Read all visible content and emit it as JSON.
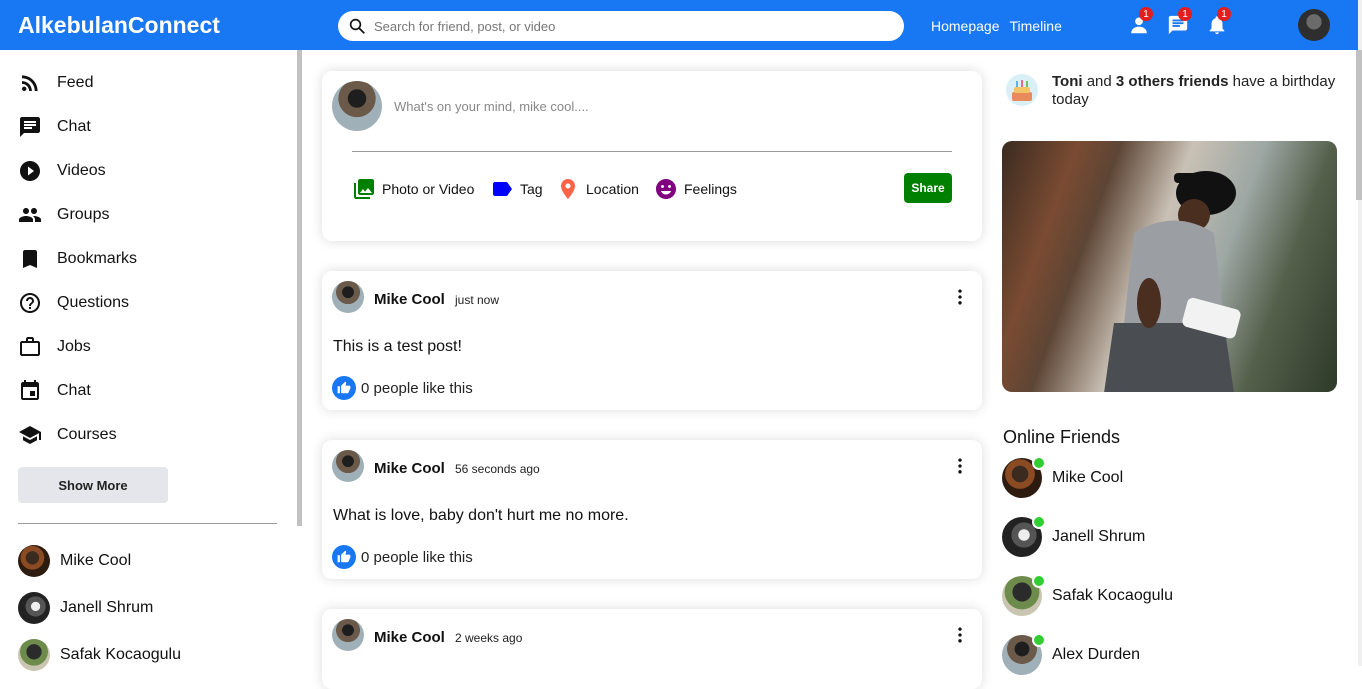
{
  "topbar": {
    "logo": "AlkebulanConnect",
    "search_placeholder": "Search for friend, post, or video",
    "links": [
      "Homepage",
      "Timeline"
    ],
    "badges": {
      "friends": "1",
      "messages": "1",
      "notifications": "1"
    }
  },
  "sidebar": {
    "items": [
      {
        "label": "Feed",
        "icon": "rss-feed-icon"
      },
      {
        "label": "Chat",
        "icon": "chat-icon"
      },
      {
        "label": "Videos",
        "icon": "play-circle-icon"
      },
      {
        "label": "Groups",
        "icon": "group-icon"
      },
      {
        "label": "Bookmarks",
        "icon": "bookmark-icon"
      },
      {
        "label": "Questions",
        "icon": "help-outline-icon"
      },
      {
        "label": "Jobs",
        "icon": "work-outline-icon"
      },
      {
        "label": "Chat",
        "icon": "event-icon"
      },
      {
        "label": "Courses",
        "icon": "school-icon"
      }
    ],
    "show_more": "Show More",
    "friends": [
      "Mike Cool",
      "Janell Shrum",
      "Safak Kocaogulu"
    ]
  },
  "share": {
    "placeholder": "What's on your mind, mike cool....",
    "options": [
      "Photo or Video",
      "Tag",
      "Location",
      "Feelings"
    ],
    "button": "Share",
    "colors": {
      "photo": "#008000",
      "tag": "#0000ff",
      "location": "#ff6347",
      "feelings": "#800080"
    }
  },
  "posts": [
    {
      "user": "Mike Cool",
      "date": "just now",
      "text": "This is a test post!",
      "likes": "0 people like this"
    },
    {
      "user": "Mike Cool",
      "date": "56 seconds ago",
      "text": "What is love, baby don't hurt me no more.",
      "likes": "0 people like this"
    },
    {
      "user": "Mike Cool",
      "date": "2 weeks ago",
      "text": "",
      "likes": ""
    }
  ],
  "rightbar": {
    "birthday": {
      "name": "Toni",
      "mid": " and ",
      "others": "3 others friends",
      "rest": " have a birthday today"
    },
    "online_title": "Online Friends",
    "online": [
      "Mike Cool",
      "Janell Shrum",
      "Safak Kocaogulu",
      "Alex Durden"
    ]
  },
  "colors": {
    "brand": "#1877f2",
    "online": "#32cd32",
    "badge": "#e41e1e",
    "share_button": "#008000"
  }
}
